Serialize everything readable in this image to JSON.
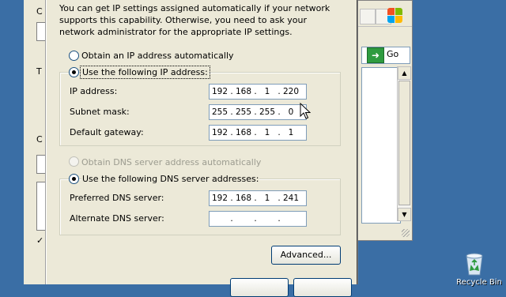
{
  "background_window": {
    "fragments": [
      "C",
      "T",
      "C"
    ],
    "checkbox_glyph": "✓"
  },
  "dialog": {
    "description": "You can get IP settings assigned automatically if your network supports this capability. Otherwise, you need to ask your network administrator for the appropriate IP settings.",
    "ip_mode": {
      "auto_label": "Obtain an IP address automatically",
      "manual_label": "Use the following IP address:",
      "selected": "manual"
    },
    "ip_address": {
      "label": "IP address:",
      "octets": [
        "192",
        "168",
        "1",
        "220"
      ]
    },
    "subnet_mask": {
      "label": "Subnet mask:",
      "octets": [
        "255",
        "255",
        "255",
        "0"
      ]
    },
    "default_gateway": {
      "label": "Default gateway:",
      "octets": [
        "192",
        "168",
        "1",
        "1"
      ]
    },
    "dns_mode": {
      "auto_label": "Obtain DNS server address automatically",
      "manual_label": "Use the following DNS server addresses:",
      "selected": "manual"
    },
    "preferred_dns": {
      "label": "Preferred DNS server:",
      "octets": [
        "192",
        "168",
        "1",
        "241"
      ]
    },
    "alternate_dns": {
      "label": "Alternate DNS server:",
      "octets": [
        "",
        "",
        "",
        ""
      ]
    },
    "advanced_button": "Advanced..."
  },
  "explorer": {
    "go_label": "Go"
  },
  "desktop": {
    "recycle_bin_label": "Recycle Bin"
  },
  "colors": {
    "desktop": "#3a6ea5",
    "dialog_face": "#ece9d8",
    "go_green": "#2e9b3f",
    "field_border": "#7f9db9"
  }
}
